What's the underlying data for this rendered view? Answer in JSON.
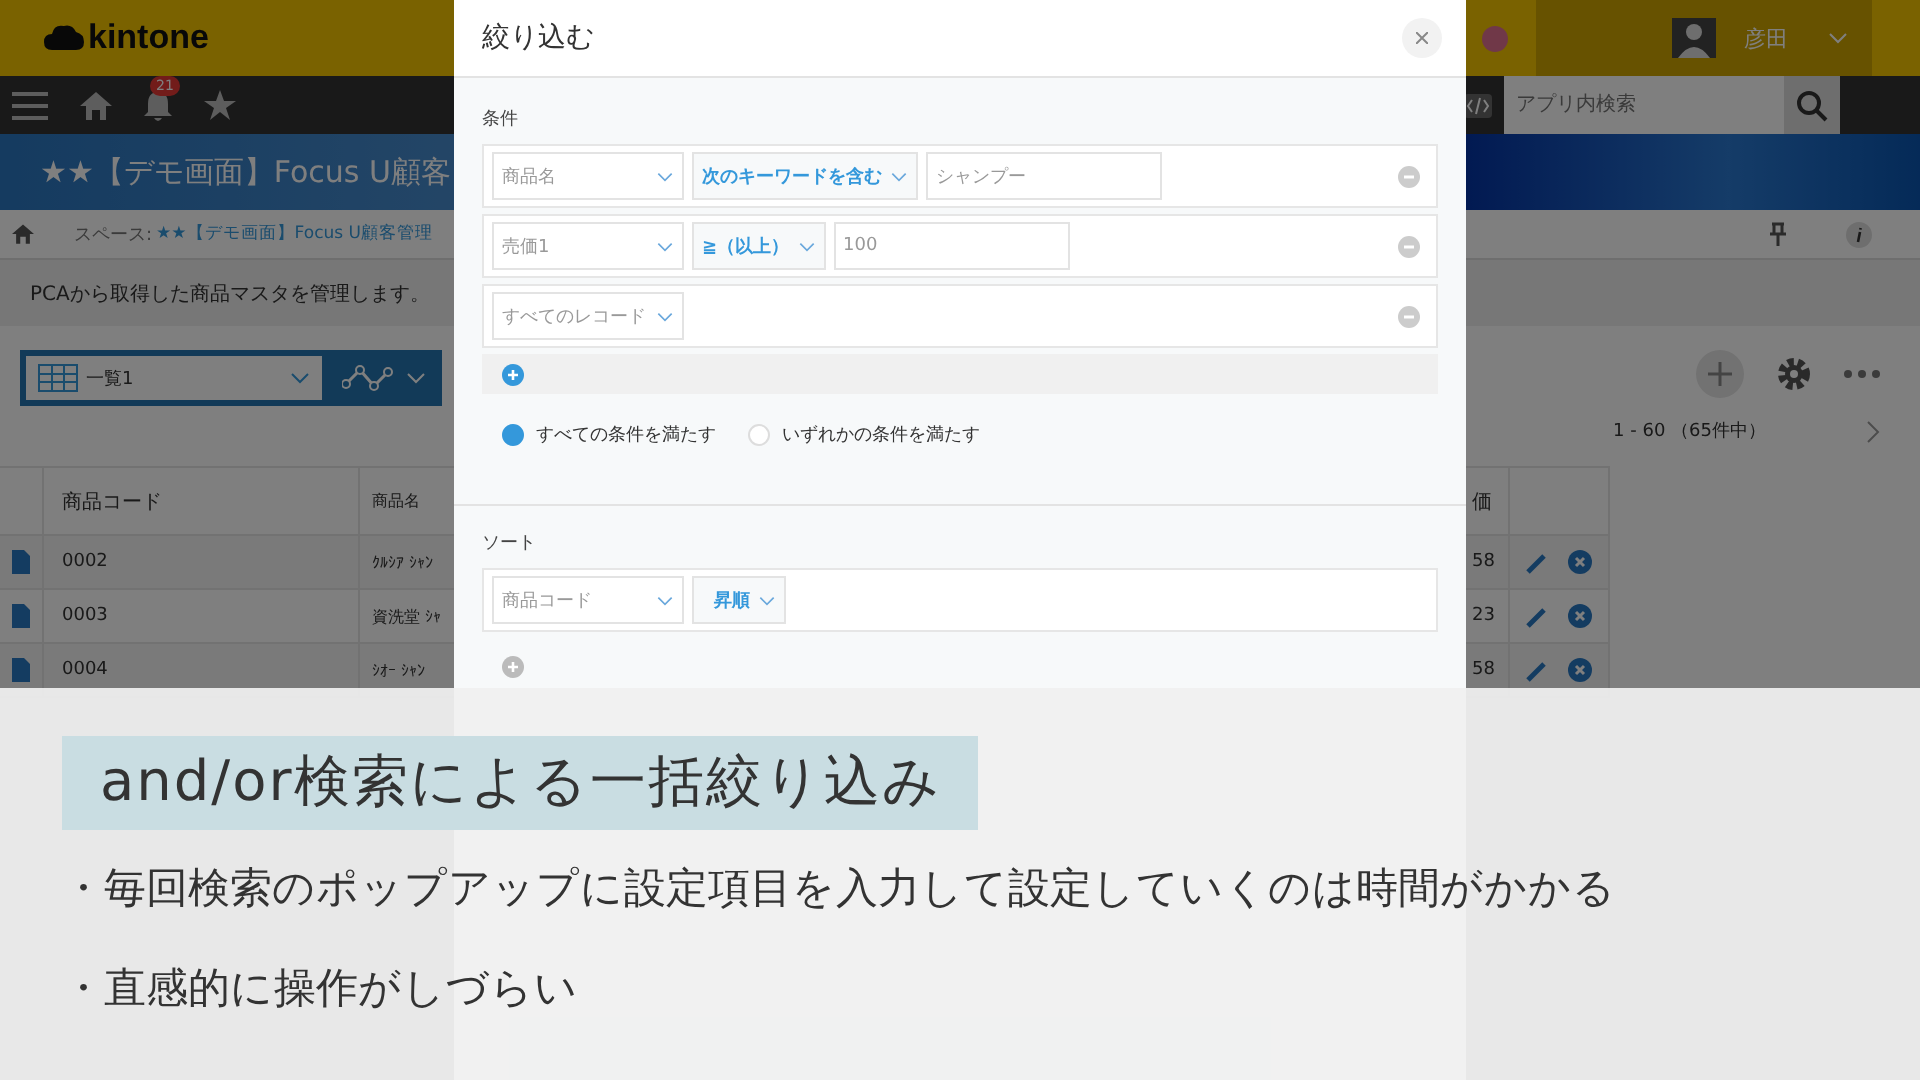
{
  "header": {
    "logo": "kintone",
    "user_name": "彦田"
  },
  "nav": {
    "notification_count": "21",
    "search": {
      "placeholder": "アプリ内検索"
    }
  },
  "app_title": "★★【デモ画面】Focus U顧客",
  "breadcrumb": {
    "prefix": "スペース:",
    "link": "★★【デモ画面】Focus U顧客管理"
  },
  "description": "PCAから取得した商品マスタを管理します。",
  "view_select": "一覧1",
  "pagination": "1 - 60 （65件中）",
  "table": {
    "columns": [
      "商品コード",
      "商品名",
      "価"
    ],
    "rows": [
      {
        "cells": [
          "0002",
          "ｸﾙｼｱ ｼｬﾝ",
          "58"
        ]
      },
      {
        "cells": [
          "0003",
          "資洗堂 ｼｬ",
          "23"
        ]
      },
      {
        "cells": [
          "0004",
          "ｼｵｰ ｼｬﾝ",
          "58"
        ]
      }
    ]
  },
  "filter_dialog": {
    "title": "絞り込む",
    "conditions_label": "条件",
    "conditions": [
      {
        "field": "商品名",
        "operator": "次のキーワードを含む",
        "value": "シャンプー"
      },
      {
        "field": "売価1",
        "operator": "≧（以上）",
        "value": "100"
      },
      {
        "field": "すべてのレコード"
      }
    ],
    "match_options": [
      {
        "label": "すべての条件を満たす",
        "selected": true
      },
      {
        "label": "いずれかの条件を満たす",
        "selected": false
      }
    ],
    "sort_label": "ソート",
    "sorts": [
      {
        "field": "商品コード",
        "order": "昇順"
      }
    ]
  },
  "caption": {
    "title": "and/or検索による一括絞り込み",
    "bullets": [
      "・毎回検索のポップアップに設定項目を入力して設定していくのは時間がかかる",
      "・直感的に操作がしづらい"
    ]
  }
}
